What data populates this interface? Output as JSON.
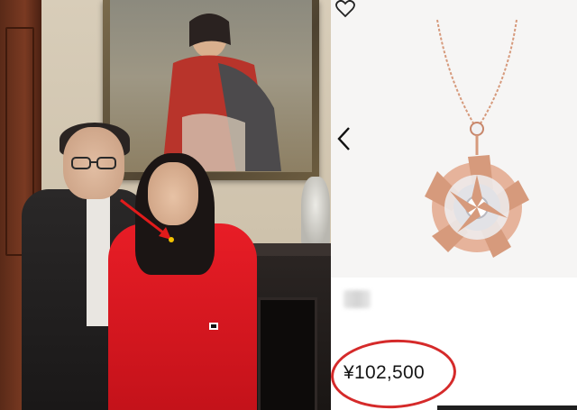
{
  "product": {
    "price": "¥102,500",
    "icons": {
      "favorite": "heart-outline-icon",
      "previous": "chevron-left-icon"
    },
    "colors": {
      "accent_ring": "#d52a2a",
      "necklace_gold": "#d69a7c",
      "diamond": "#f0f0f2"
    }
  },
  "photo": {
    "colors": {
      "sweater": "#e81d26",
      "suit": "#222020",
      "door": "#6e3320"
    }
  }
}
